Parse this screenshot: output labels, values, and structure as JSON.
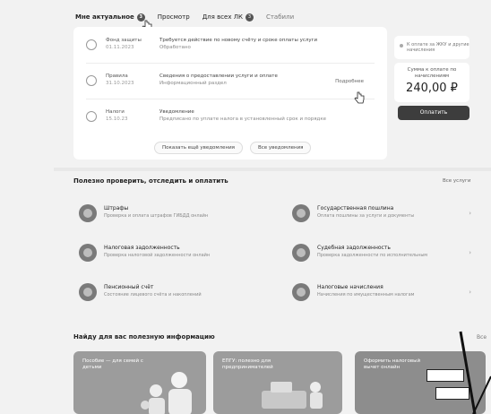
{
  "tabs": [
    {
      "label": "Мне актуальное",
      "count": "3",
      "active": true
    },
    {
      "label": "Просмотр",
      "count": "",
      "active": false
    },
    {
      "label": "Для всех ЛК",
      "count": "3",
      "active": false
    },
    {
      "label": "Стабили",
      "count": "",
      "active": false
    }
  ],
  "notifications": [
    {
      "source": "Фонд защиты",
      "date": "01.11.2023",
      "text": "Требуется действие по новому счёту и сроке оплаты услуги",
      "sub": "Обработано"
    },
    {
      "source": "Правила",
      "date": "31.10.2023",
      "text": "Сведения о предоставлении услуги и оплате",
      "sub": "Информационный раздел",
      "more": "Подробнее"
    },
    {
      "source": "Налоги",
      "date": "15.10.23",
      "text": "Уведомление",
      "sub": "Предписано по уплате налога в установленный срок и порядке"
    }
  ],
  "notif_buttons": [
    "Показать ещё уведомления",
    "Все уведомления"
  ],
  "payment": {
    "info": "К оплате за ЖКУ и другие начисления",
    "label": "Сумма к оплате по начислениям",
    "amount": "240,00 ₽",
    "button": "Оплатить"
  },
  "services_section": {
    "title": "Полезно проверить, отследить и оплатить",
    "link": "Все услуги",
    "items": [
      {
        "name": "Штрафы",
        "desc": "Проверка и оплата штрафов ГИБДД онлайн"
      },
      {
        "name": "Государственная пошлина",
        "desc": "Оплата пошлины за услуги и документы"
      },
      {
        "name": "Налоговая задолженность",
        "desc": "Проверка налоговой задолженности онлайн"
      },
      {
        "name": "Судебная задолженность",
        "desc": "Проверка задолженности по исполнительным"
      },
      {
        "name": "Пенсионный счёт",
        "desc": "Состояние лицевого счёта и накоплений"
      },
      {
        "name": "Налоговые начисления",
        "desc": "Начисления по имущественным налогам"
      }
    ]
  },
  "info_section": {
    "title": "Найду для вас полезную информацию",
    "link": "Все",
    "banners": [
      {
        "text": "Пособие — для семей с детьми"
      },
      {
        "text": "ЕПГУ: полезно для предпринимателей"
      },
      {
        "text": "Оформить налоговый вычет онлайн"
      }
    ]
  },
  "colors": {
    "accent": "#3d3d3d",
    "background": "#f2f2f2"
  }
}
